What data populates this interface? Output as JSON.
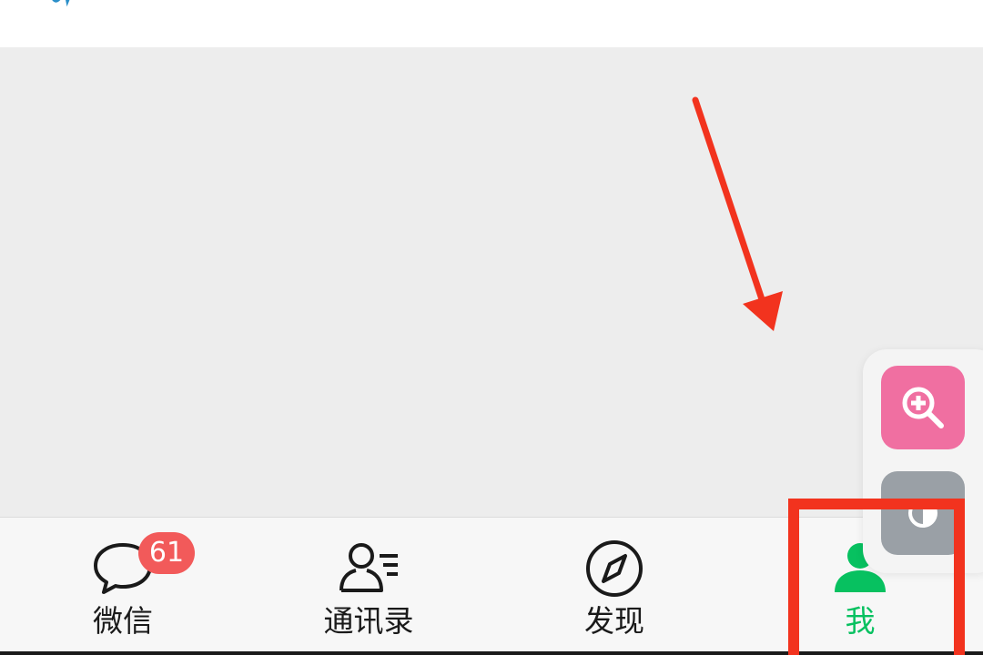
{
  "colors": {
    "accent_green": "#07c160",
    "badge_red": "#f25a5a",
    "annotation_red": "#f2331e",
    "zoom_pink": "#f06fa1",
    "contrast_gray": "#9aa0a6"
  },
  "tabbar": {
    "tabs": [
      {
        "label": "微信",
        "icon": "chat-bubble-icon",
        "badge": "61",
        "active": false
      },
      {
        "label": "通讯录",
        "icon": "contacts-icon",
        "active": false
      },
      {
        "label": "发现",
        "icon": "compass-icon",
        "active": false
      },
      {
        "label": "我",
        "icon": "person-icon",
        "active": true
      }
    ]
  },
  "floating_tools": {
    "buttons": [
      {
        "icon": "zoom-in-icon"
      },
      {
        "icon": "contrast-icon"
      }
    ]
  },
  "annotations": {
    "arrow": "red-arrow-icon",
    "highlight": "red-highlight-box"
  }
}
